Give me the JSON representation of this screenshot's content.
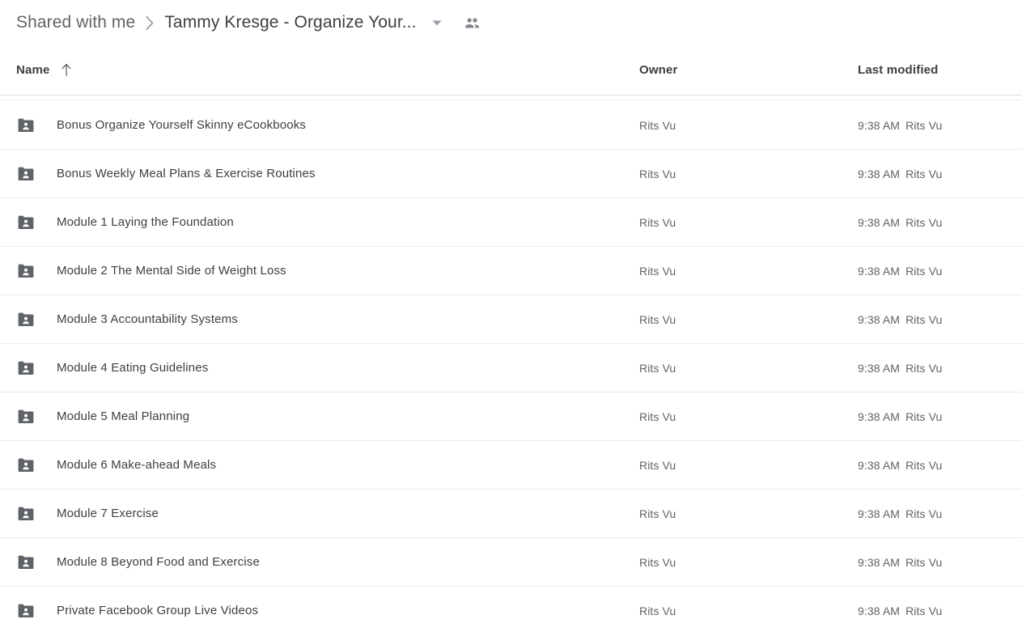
{
  "breadcrumb": {
    "root_label": "Shared with me",
    "separator_icon": "chevron-right-icon",
    "current_label": "Tammy Kresge - Organize Your...",
    "caret_icon": "chevron-down-icon",
    "people_icon": "people-shared-icon"
  },
  "columns": {
    "name": "Name",
    "sort_icon": "arrow-up-icon",
    "owner": "Owner",
    "last_modified": "Last modified"
  },
  "colors": {
    "folder": "#5f6368",
    "text_primary": "#3c4043",
    "text_secondary": "#5f6368",
    "divider": "#e8eaed",
    "background": "#ffffff"
  },
  "rows": [
    {
      "icon": "shared-folder-icon",
      "name": "Bonus Organize Yourself Skinny eCookbooks",
      "owner": "Rits Vu",
      "modified_time": "9:38 AM",
      "modified_by": "Rits Vu"
    },
    {
      "icon": "shared-folder-icon",
      "name": "Bonus Weekly Meal Plans & Exercise Routines",
      "owner": "Rits Vu",
      "modified_time": "9:38 AM",
      "modified_by": "Rits Vu"
    },
    {
      "icon": "shared-folder-icon",
      "name": "Module 1 Laying the Foundation",
      "owner": "Rits Vu",
      "modified_time": "9:38 AM",
      "modified_by": "Rits Vu"
    },
    {
      "icon": "shared-folder-icon",
      "name": "Module 2 The Mental Side of Weight Loss",
      "owner": "Rits Vu",
      "modified_time": "9:38 AM",
      "modified_by": "Rits Vu"
    },
    {
      "icon": "shared-folder-icon",
      "name": "Module 3 Accountability Systems",
      "owner": "Rits Vu",
      "modified_time": "9:38 AM",
      "modified_by": "Rits Vu"
    },
    {
      "icon": "shared-folder-icon",
      "name": "Module 4 Eating Guidelines",
      "owner": "Rits Vu",
      "modified_time": "9:38 AM",
      "modified_by": "Rits Vu"
    },
    {
      "icon": "shared-folder-icon",
      "name": "Module 5 Meal Planning",
      "owner": "Rits Vu",
      "modified_time": "9:38 AM",
      "modified_by": "Rits Vu"
    },
    {
      "icon": "shared-folder-icon",
      "name": "Module 6 Make-ahead Meals",
      "owner": "Rits Vu",
      "modified_time": "9:38 AM",
      "modified_by": "Rits Vu"
    },
    {
      "icon": "shared-folder-icon",
      "name": "Module 7 Exercise",
      "owner": "Rits Vu",
      "modified_time": "9:38 AM",
      "modified_by": "Rits Vu"
    },
    {
      "icon": "shared-folder-icon",
      "name": "Module 8 Beyond Food and Exercise",
      "owner": "Rits Vu",
      "modified_time": "9:38 AM",
      "modified_by": "Rits Vu"
    },
    {
      "icon": "shared-folder-icon",
      "name": "Private Facebook Group Live Videos",
      "owner": "Rits Vu",
      "modified_time": "9:38 AM",
      "modified_by": "Rits Vu"
    }
  ]
}
